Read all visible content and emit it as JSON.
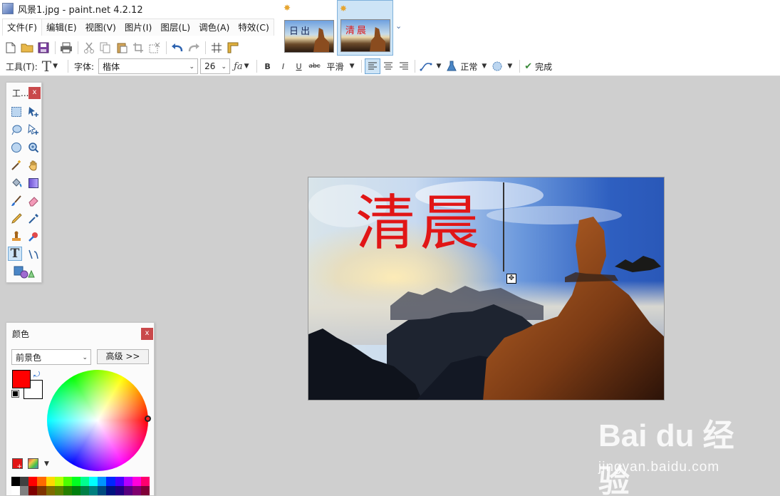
{
  "window": {
    "title": "风景1.jpg - paint.net 4.2.12"
  },
  "menu": {
    "items": [
      "文件(F)",
      "编辑(E)",
      "视图(V)",
      "图片(I)",
      "图层(L)",
      "调色(A)",
      "特效(C)"
    ]
  },
  "image_tabs": [
    {
      "label": "日出",
      "text_color": "#1b2b5a"
    },
    {
      "label": "清晨",
      "text_color": "#e11616"
    }
  ],
  "toolbar": {
    "tool_label": "工具(T):",
    "font_label": "字体:",
    "font_value": "楷体",
    "font_size": "26",
    "antialias": "平滑",
    "blend_mode": "正常",
    "finish_label": "完成",
    "bold": "B",
    "italic": "I",
    "underline": "U",
    "strike": "abc"
  },
  "tools_panel": {
    "title": "工...",
    "close": "x"
  },
  "colors_panel": {
    "title": "颜色",
    "close": "x",
    "mode_value": "前景色",
    "advanced_label": "高级 >>",
    "primary_color": "#ff0000",
    "secondary_color": "#ffffff"
  },
  "palette": [
    "#000000",
    "#404040",
    "#ff0000",
    "#ff6a00",
    "#ffd800",
    "#b6ff00",
    "#4cff00",
    "#00ff21",
    "#00ff90",
    "#00ffff",
    "#0094ff",
    "#0026ff",
    "#4800ff",
    "#b200ff",
    "#ff00dc",
    "#ff006e",
    "#ffffff",
    "#808080",
    "#7f0000",
    "#7f3300",
    "#7f6a00",
    "#5b7f00",
    "#267f00",
    "#007f0e",
    "#007f46",
    "#007f7f",
    "#004a7f",
    "#00137f",
    "#21007f",
    "#57007f",
    "#7f006e",
    "#7f0037"
  ],
  "canvas": {
    "text": "清晨"
  },
  "watermark": {
    "brand": "Bai du 经验",
    "url": "jingyan.baidu.com"
  }
}
